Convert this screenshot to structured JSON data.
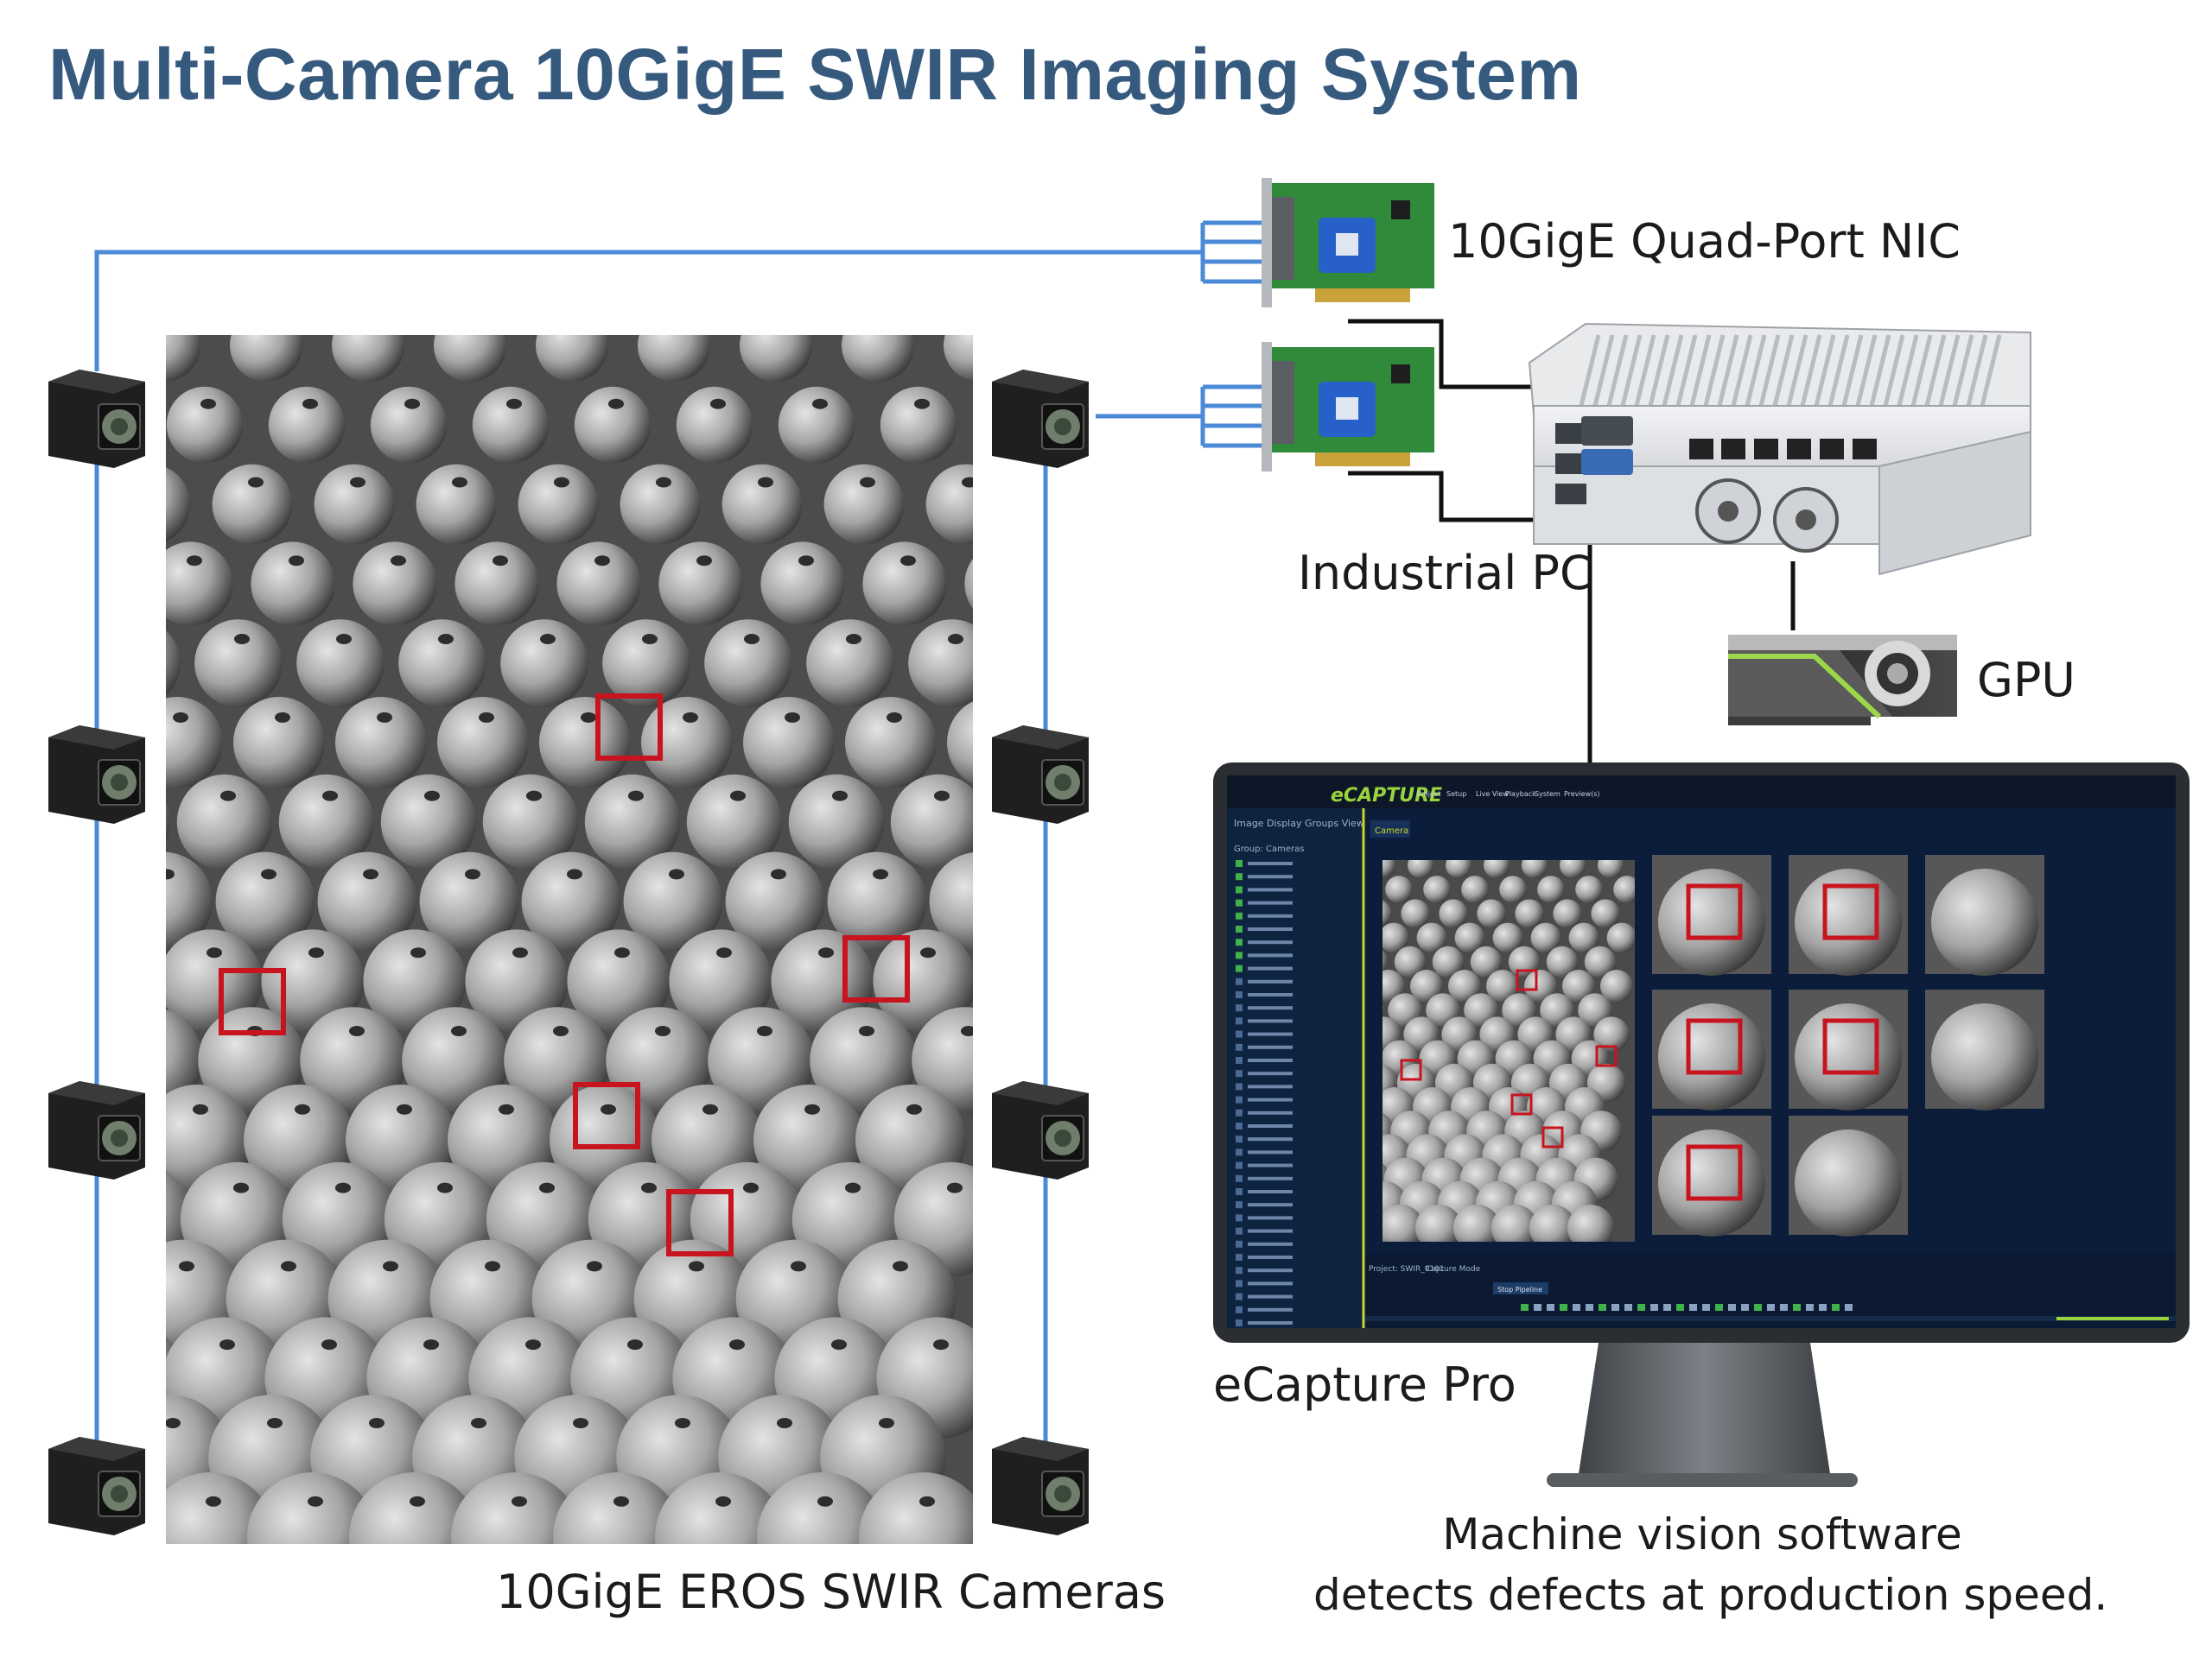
{
  "title": "Multi-Camera 10GigE SWIR Imaging System",
  "labels": {
    "nic": "10GigE Quad-Port NIC",
    "pc": "Industrial PC",
    "gpu": "GPU",
    "software": "eCapture Pro",
    "caption_line1": "Machine vision software",
    "caption_line2": "detects defects at production speed.",
    "cameras": "10GigE EROS SWIR Cameras"
  },
  "colors": {
    "title": "#365a7e",
    "network_line": "#4a8ad6",
    "defect_box": "#c8141e",
    "power_line": "#111111",
    "nic_board": "#2f8a3a",
    "nic_chip": "#2660c8"
  },
  "icons": {
    "camera": "camera-icon",
    "nic": "network-card-icon",
    "pc": "industrial-pc-icon",
    "gpu": "gpu-icon",
    "monitor": "monitor-icon"
  },
  "software_ui": {
    "logo": "eCAPTURE",
    "menu": [
      "Project",
      "Setup",
      "Live View",
      "Playback",
      "System",
      "Preview(s)"
    ],
    "panel_title": "Image Display Groups View",
    "group_label": "Group: Cameras",
    "tab": "Camera",
    "status_left": "Project: SWIR_0101",
    "status_mode": "Capture Mode",
    "stop_button": "Stop Pipeline"
  }
}
